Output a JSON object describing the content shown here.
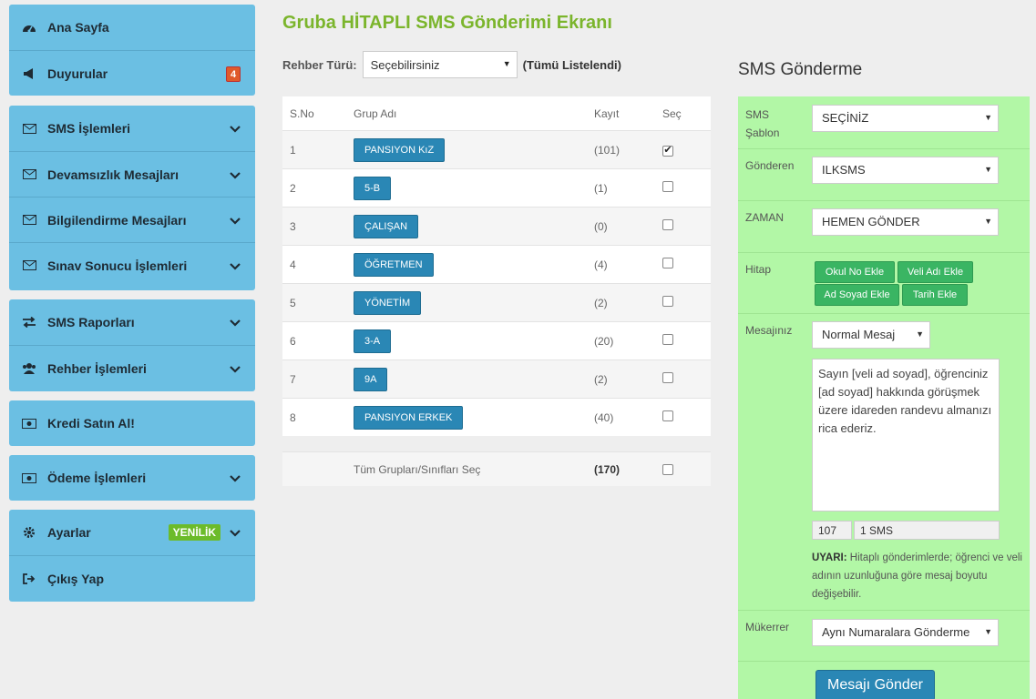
{
  "sidebar": {
    "home": {
      "label": "Ana Sayfa",
      "icon": "dashboard-icon"
    },
    "announcements": {
      "label": "Duyurular",
      "badge": "4",
      "icon": "megaphone-icon"
    },
    "sms_ops": {
      "label": "SMS İşlemleri",
      "icon": "envelope-icon"
    },
    "absence": {
      "label": "Devamsızlık Mesajları",
      "icon": "envelope-icon"
    },
    "info": {
      "label": "Bilgilendirme Mesajları",
      "icon": "envelope-icon"
    },
    "exam": {
      "label": "Sınav Sonucu İşlemleri",
      "icon": "envelope-icon"
    },
    "reports": {
      "label": "SMS Raporları",
      "icon": "exchange-icon"
    },
    "contacts": {
      "label": "Rehber İşlemleri",
      "icon": "users-icon"
    },
    "credit": {
      "label": "Kredi Satın Al!",
      "icon": "money-icon"
    },
    "payment": {
      "label": "Ödeme İşlemleri",
      "icon": "money-icon"
    },
    "settings": {
      "label": "Ayarlar",
      "badge": "YENİLİK",
      "icon": "gear-icon"
    },
    "logout": {
      "label": "Çıkış Yap",
      "icon": "sign-out-icon"
    }
  },
  "page": {
    "title": "Gruba HİTAPLI SMS Gönderimi Ekranı",
    "rehber_label": "Rehber Türü:",
    "rehber_value": "Seçebilirsiniz",
    "rehber_note": "(Tümü Listelendi)"
  },
  "table": {
    "headers": {
      "no": "S.No",
      "name": "Grup Adı",
      "count": "Kayıt",
      "select": "Seç"
    },
    "rows": [
      {
        "no": "1",
        "name": "PANSIYON KıZ",
        "count": "(101)",
        "checked": true
      },
      {
        "no": "2",
        "name": "5-B",
        "count": "(1)",
        "checked": false
      },
      {
        "no": "3",
        "name": "ÇALIŞAN",
        "count": "(0)",
        "checked": false
      },
      {
        "no": "4",
        "name": "ÖĞRETMEN",
        "count": "(4)",
        "checked": false
      },
      {
        "no": "5",
        "name": "YÖNETİM",
        "count": "(2)",
        "checked": false
      },
      {
        "no": "6",
        "name": "3-A",
        "count": "(20)",
        "checked": false
      },
      {
        "no": "7",
        "name": "9A",
        "count": "(2)",
        "checked": false
      },
      {
        "no": "8",
        "name": "PANSIYON ERKEK",
        "count": "(40)",
        "checked": false
      }
    ],
    "footer": {
      "label": "Tüm Grupları/Sınıfları Seç",
      "total": "(170)"
    }
  },
  "sms": {
    "title": "SMS Gönderme",
    "template_label": "SMS Şablon",
    "template_value": "SEÇİNİZ",
    "sender_label": "Gönderen",
    "sender_value": "ILKSMS",
    "time_label": "ZAMAN",
    "time_value": "HEMEN GÖNDER",
    "hitap_label": "Hitap",
    "hitap_buttons": [
      "Okul No Ekle",
      "Veli Adı Ekle",
      "Ad Soyad Ekle",
      "Tarih Ekle"
    ],
    "message_label": "Mesajınız",
    "message_type": "Normal Mesaj",
    "message_text": "Sayın [veli ad soyad], öğrenciniz [ad soyad] hakkında görüşmek üzere idareden randevu almanızı rica ederiz.",
    "char_count": "107",
    "sms_count": "1 SMS",
    "warning_title": "UYARI:",
    "warning_text": "Hitaplı gönderimlerde; öğrenci ve veli adının uzunluğuna göre mesaj boyutu değişebilir.",
    "repeat_label": "Mükerrer",
    "repeat_value": "Aynı Numaralara Gönderme",
    "send_label": "Mesajı Gönder"
  }
}
